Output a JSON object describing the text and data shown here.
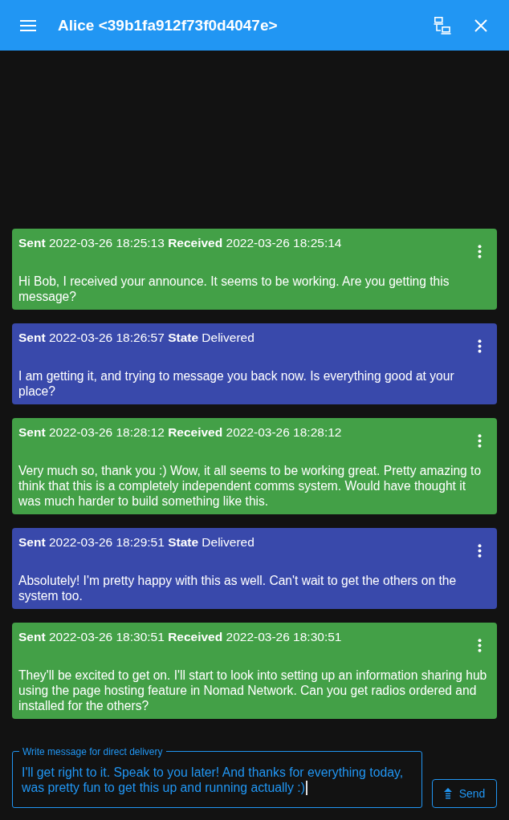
{
  "app_bar": {
    "title": "Alice <39b1fa912f73f0d4047e>"
  },
  "messages": [
    {
      "kind": "incoming",
      "meta": "**Sent** 2022-03-26 18:25:13 **Received** 2022-03-26 18:25:14",
      "text": "Hi Bob, I received your announce. It seems to be working. Are you getting this message?"
    },
    {
      "kind": "outgoing",
      "meta": "**Sent** 2022-03-26 18:26:57 **State** Delivered",
      "text": "I am getting it, and trying to message you back now. Is everything good at your place?"
    },
    {
      "kind": "incoming",
      "meta": "**Sent** 2022-03-26 18:28:12 **Received** 2022-03-26 18:28:12",
      "text": "Very much so, thank you :) Wow, it all seems to be working great. Pretty amazing to think that this is a completely independent comms system. Would have thought it was much harder to build something like this."
    },
    {
      "kind": "outgoing",
      "meta": "**Sent** 2022-03-26 18:29:51 **State** Delivered",
      "text": "Absolutely! I'm pretty happy with this as well. Can't wait to get the others on the system too."
    },
    {
      "kind": "incoming",
      "meta": "**Sent** 2022-03-26 18:30:51 **Received** 2022-03-26 18:30:51",
      "text": "They'll be excited to get on. I'll start to look into setting up an information sharing hub using the page hosting feature in Nomad Network. Can you get radios ordered and installed for the others?"
    }
  ],
  "composer": {
    "label": "Write message for direct delivery",
    "value": "I'll get right to it. Speak to you later! And thanks for everything today, was pretty fun to get this up and running actually :)",
    "focused": true
  },
  "send_button": {
    "label": "Send"
  }
}
